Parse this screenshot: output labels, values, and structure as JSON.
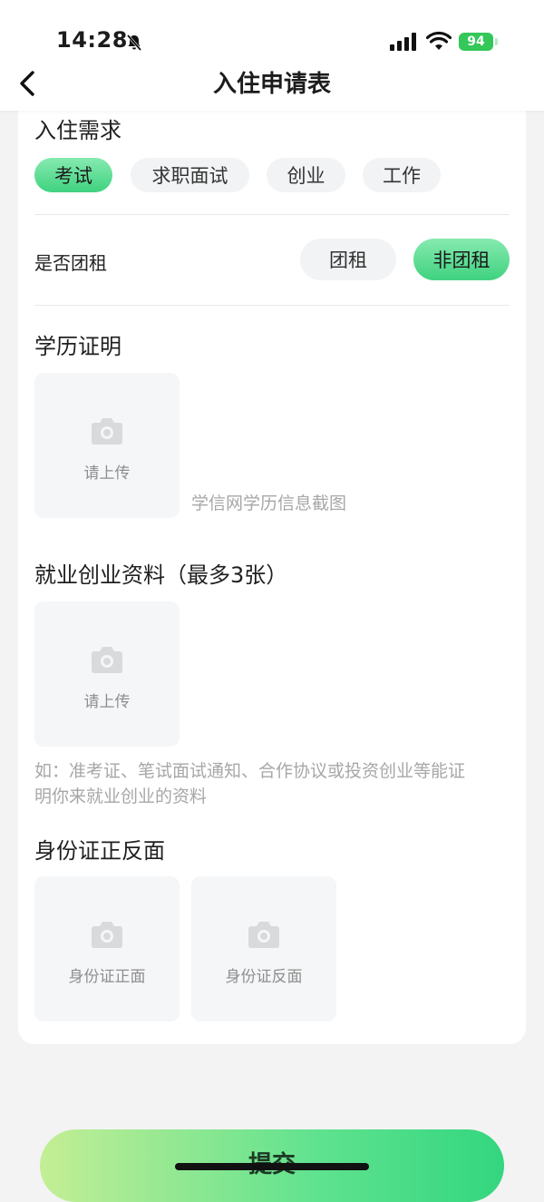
{
  "status_bar": {
    "time": "14:28",
    "battery": "94"
  },
  "nav": {
    "title": "入住申请表"
  },
  "needs": {
    "title": "入住需求",
    "options": [
      "考试",
      "求职面试",
      "创业",
      "工作"
    ],
    "selected": "考试"
  },
  "group_rent": {
    "label": "是否团租",
    "options": [
      "团租",
      "非团租"
    ],
    "selected": "非团租"
  },
  "education": {
    "title": "学历证明",
    "upload_label": "请上传",
    "hint": "学信网学历信息截图"
  },
  "employment": {
    "title": "就业创业资料（最多3张）",
    "upload_label": "请上传",
    "hint_line1": "如：准考证、笔试面试通知、合作协议或投资创业等能证",
    "hint_line2": "明你来就业创业的资料"
  },
  "id_card": {
    "title": "身份证正反面",
    "front_label": "身份证正面",
    "back_label": "身份证反面"
  },
  "submit_label": "提交",
  "colors": {
    "accent": "#3fd27f",
    "accent_light": "#86eab0",
    "battery": "#34c759"
  },
  "icons": [
    "bell-slash-icon",
    "signal-icon",
    "wifi-icon",
    "battery-icon",
    "back-chevron-icon",
    "camera-icon"
  ]
}
